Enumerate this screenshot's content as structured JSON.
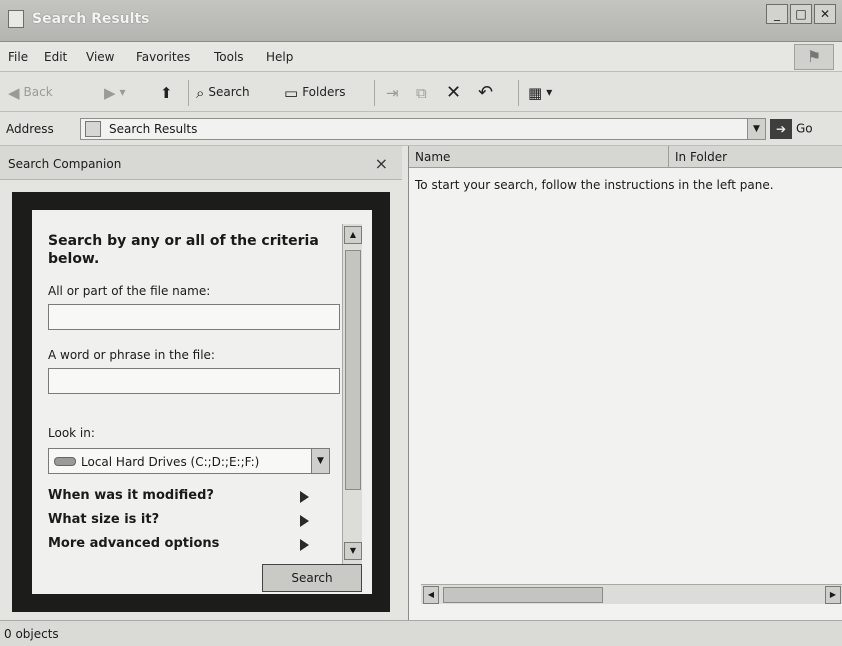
{
  "window": {
    "title": "Search Results",
    "controls": {
      "minimize": "_",
      "maximize": "□",
      "close": "✕"
    }
  },
  "menu": [
    "File",
    "Edit",
    "View",
    "Favorites",
    "Tools",
    "Help"
  ],
  "toolbar": {
    "back_label": "Back",
    "search_label": "Search",
    "folders_label": "Folders"
  },
  "address": {
    "label": "Address",
    "value": "Search Results",
    "go_label": "Go"
  },
  "search_companion": {
    "title": "Search Companion",
    "close": "×",
    "heading": "Search by any or all of the criteria below.",
    "filename_label": "All or part of the file name:",
    "filename_value": "",
    "word_label": "A word or phrase in the file:",
    "word_value": "",
    "lookin_label": "Look in:",
    "lookin_value": "Local Hard Drives (C:;D:;E:;F:)",
    "options": [
      "When was it modified?",
      "What size is it?",
      "More advanced options"
    ],
    "search_button": "Search"
  },
  "results": {
    "columns": [
      "Name",
      "In Folder"
    ],
    "hint": "To start your search, follow the instructions in the left pane."
  },
  "status": {
    "text": "0 objects"
  },
  "icons": {
    "title": "search-results-window-icon",
    "back": "back-arrow-icon",
    "forward": "forward-arrow-icon",
    "up": "up-folder-icon",
    "search": "magnifier-icon",
    "folders": "folders-icon",
    "move": "move-to-icon",
    "copy": "copy-to-icon",
    "delete": "delete-x-icon",
    "undo": "undo-icon",
    "views": "views-icon",
    "drive": "hard-drive-icon"
  }
}
